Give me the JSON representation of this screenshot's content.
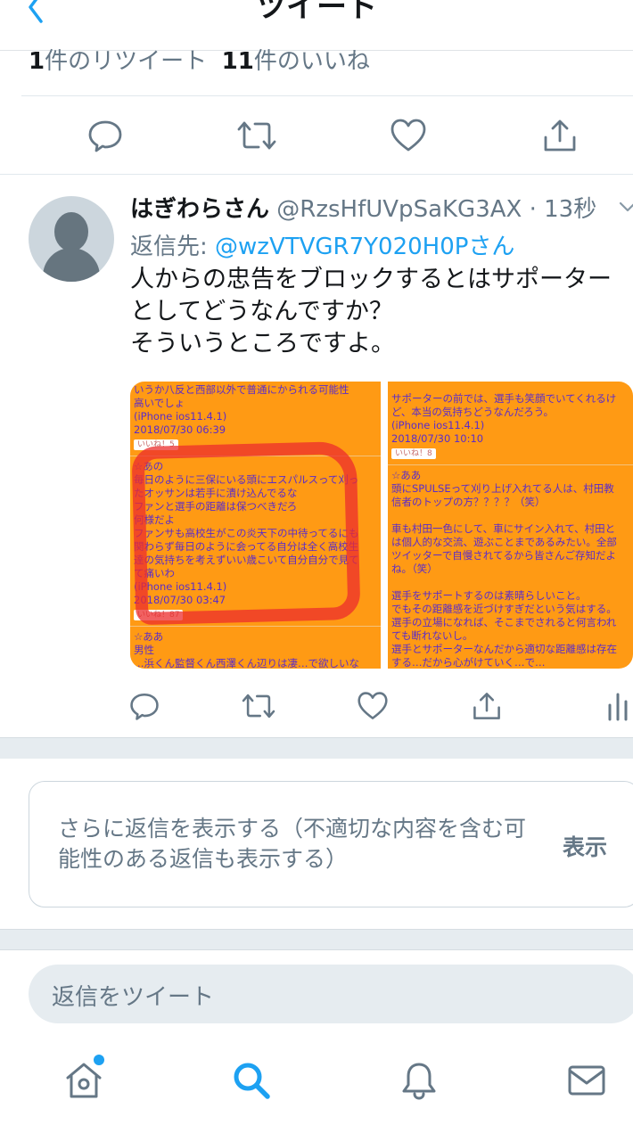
{
  "header": {
    "title": "ツイート",
    "back_icon": "chevron-left-icon"
  },
  "stats": {
    "retweet_count": "1",
    "retweet_label": "件のリツイート",
    "like_count": "11",
    "like_label": "件のいいね"
  },
  "tweet": {
    "author_name": "はぎわらさん",
    "author_handle": "@RzsHfUVpSaKG3AX",
    "time_sep": " · ",
    "time": "13秒",
    "reply_label": "返信先: ",
    "reply_mention": "@wzVTVGR7Y020H0Pさん",
    "body": "人からの忠告をブロックするとはサポーター\nとしてどうなんですか？\nそういうところですよ。",
    "media": {
      "left": {
        "lines_block1": [
          "いうか八反と西部以外で普通にかられる可能性",
          "高いでしょ",
          "(iPhone ios11.4.1)",
          "2018/07/30 06:39"
        ],
        "like1": "いいね！5",
        "lines_block2": [
          "☆あの",
          "毎日のように三保にいる頭にエスパルスって刈っ",
          "たオッサンは若手に漬け込んでるな",
          "ファンと選手の距離は保つべきだろ",
          "何様だよ",
          "ファンサも高校生がこの炎天下の中待ってるにも",
          "関わらず毎日のように会ってる自分は全く高校生",
          "達の気持ちを考えずいい歳こいて自分自分で見て",
          "て痛いわ",
          "(iPhone ios11.4.1)",
          "2018/07/30 03:47"
        ],
        "like2": "いいね！87",
        "lines_block3": [
          "☆ああ",
          "男性",
          "…浜くん監督くん西澤くん辺りは凄…で欲しいな"
        ]
      },
      "right": {
        "lines_block1": [
          "サポーターの前では、選手も笑顔でいてくれるけ",
          "ど、本当の気持ちどうなんだろう。",
          "(iPhone ios11.4.1)",
          "2018/07/30 10:10"
        ],
        "like1": "いいね！8",
        "lines_block2": [
          "☆ああ",
          "頭にSPULSEって刈り上げ入れてる人は、村田教",
          "信者のトップの方？？？？（笑）"
        ],
        "lines_block3": [
          "車も村田一色にして、車にサイン入れて、村田と",
          "は個人的な交流、遊ぶことまであるみたい。全部",
          "ツイッターで自慢されてるから皆さんご存知だよ",
          "ね。（笑）"
        ],
        "lines_block4": [
          "選手をサポートするのは素晴らしいこと。",
          "でもその距離感を近づけすぎだという気はする。",
          "選手の立場になれば、そこまでされると何言われ",
          "ても断れないし。",
          "選手とサポーターなんだから適切な距離感は存在",
          "する…だから心がけていく…で…"
        ]
      }
    }
  },
  "show_more": {
    "text": "さらに返信を表示する（不適切な内容を含む可能性のある返信も表示する）",
    "action": "表示"
  },
  "reply_box": {
    "placeholder": "返信をツイート"
  },
  "colors": {
    "accent": "#1da1f2",
    "icon_gray": "#657786",
    "media_bg": "#ff9a14",
    "media_text": "#5b2cc9",
    "marker": "#ec2c2c"
  },
  "tabbar": {
    "items": [
      "home-icon",
      "search-icon",
      "notifications-icon",
      "messages-icon"
    ],
    "active": "search-icon",
    "home_has_notification": true
  }
}
